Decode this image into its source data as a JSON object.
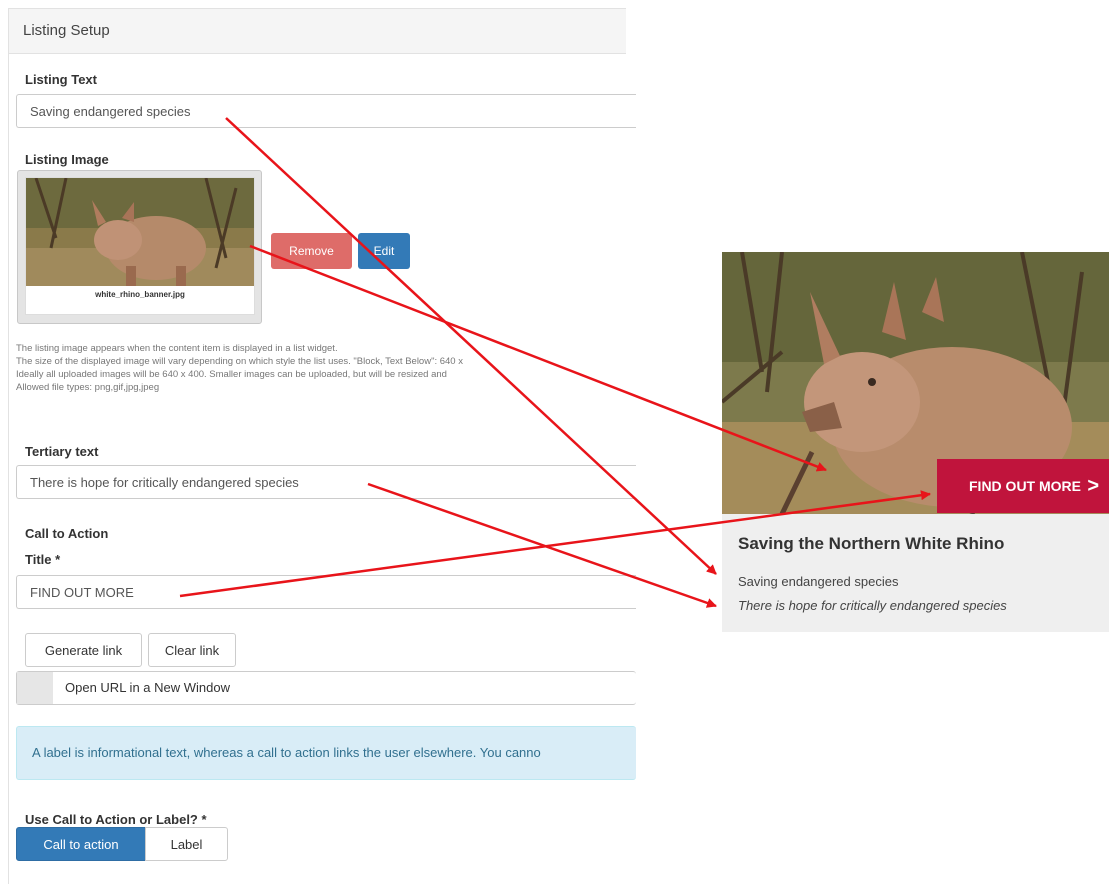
{
  "panel": {
    "title": "Listing Setup",
    "listing_text": {
      "label": "Listing Text",
      "value": "Saving endangered species"
    },
    "listing_image": {
      "label": "Listing Image",
      "filename": "white_rhino_banner.jpg",
      "remove_label": "Remove",
      "edit_label": "Edit",
      "help": [
        "The listing image appears when the content item is displayed in a list widget.",
        "The size of the displayed image will vary depending on which style the list uses. \"Block, Text Below\": 640 x",
        "Ideally all uploaded images will be 640 x 400. Smaller images can be uploaded, but will be resized and",
        "Allowed file types: png,gif,jpg,jpeg"
      ]
    },
    "tertiary_text": {
      "label": "Tertiary text",
      "value": "There is hope for critically endangered species"
    },
    "call_to_action": {
      "heading": "Call to Action",
      "title_label": "Title *",
      "title_value": "FIND OUT MORE",
      "generate_link": "Generate link",
      "clear_link": "Clear link",
      "new_window_label": "Open URL in a New Window"
    },
    "info_text": "A label is informational text, whereas a call to action links the user elsewhere. You canno",
    "use_cta_or_label": {
      "label": "Use Call to Action or Label? *",
      "options": [
        "Call to action",
        "Label"
      ],
      "selected": "Call to action"
    }
  },
  "preview_card": {
    "cta_label": "FIND OUT MORE",
    "cta_arrow": ">",
    "title": "Saving the Northern White Rhino",
    "listing_text": "Saving endangered species",
    "tertiary_text": "There is hope for critically endangered species"
  },
  "colors": {
    "arrow": "#e8141a",
    "cta": "#c0143c",
    "primary_button": "#337ab7",
    "danger_button": "#d9534f",
    "info_bg": "#d9edf7"
  }
}
